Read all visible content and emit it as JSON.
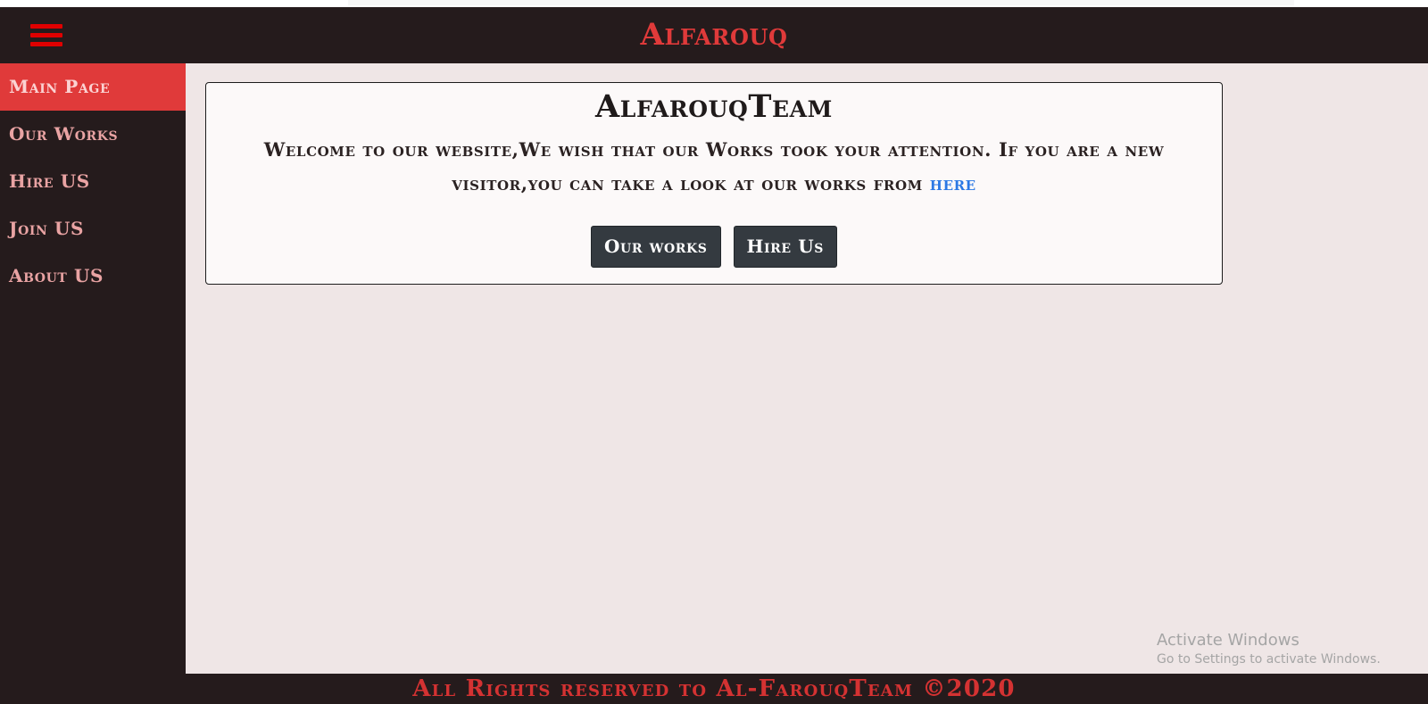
{
  "header": {
    "title": "Alfarouq",
    "menu_icon": "hamburger-menu-icon",
    "background": "#251b1c",
    "accent": "#e03a3a"
  },
  "sidebar": {
    "items": [
      {
        "label": "Main Page",
        "active": true
      },
      {
        "label": "Our Works",
        "active": false
      },
      {
        "label": "Hire US",
        "active": false
      },
      {
        "label": "Join US",
        "active": false
      },
      {
        "label": "About US",
        "active": false
      }
    ]
  },
  "welcome": {
    "title": "AlfarouqTeam",
    "text": "Welcome to our website,We wish that our Works took your attention. If you are a new visitor,you can take a look at our works from",
    "link_label": "here",
    "buttons": {
      "our_works": "Our works",
      "hire_us": "Hire Us"
    }
  },
  "watermark": {
    "title": "Activate Windows",
    "subtitle": "Go to Settings to activate Windows."
  },
  "footer": {
    "text": "All Rights reserved to Al-FarouqTeam ©2020"
  }
}
